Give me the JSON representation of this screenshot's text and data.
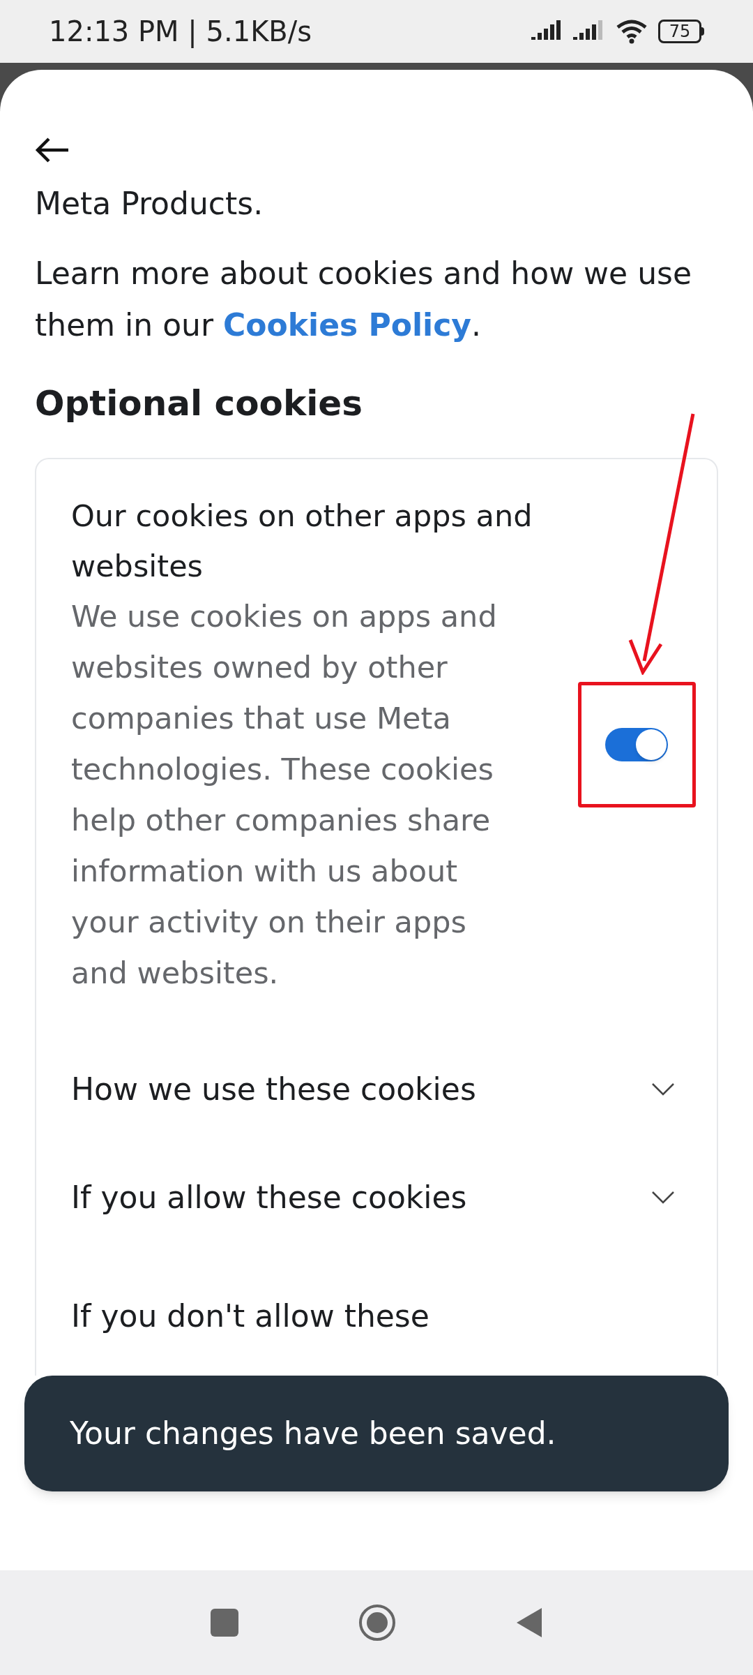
{
  "status_bar": {
    "time": "12:13 PM | 5.1KB/s",
    "battery": "75"
  },
  "intro_cut": "Meta Products.",
  "learn_more": {
    "text": "Learn more about cookies and how we use them in our ",
    "link": "Cookies Policy",
    "end": "."
  },
  "section_title": "Optional cookies",
  "card": {
    "title": "Our cookies on other apps and websites",
    "description": "We use cookies on apps and websites owned by other companies that use Meta technologies. These cookies help other companies share information with us about your activity on their apps and websites.",
    "toggle": {
      "on": true
    },
    "sections": [
      {
        "label": "How we use these cookies",
        "expanded": false
      },
      {
        "label": "If you allow these cookies",
        "expanded": false
      },
      {
        "label": "If you don't allow these"
      }
    ]
  },
  "toast": "Your changes have been saved."
}
